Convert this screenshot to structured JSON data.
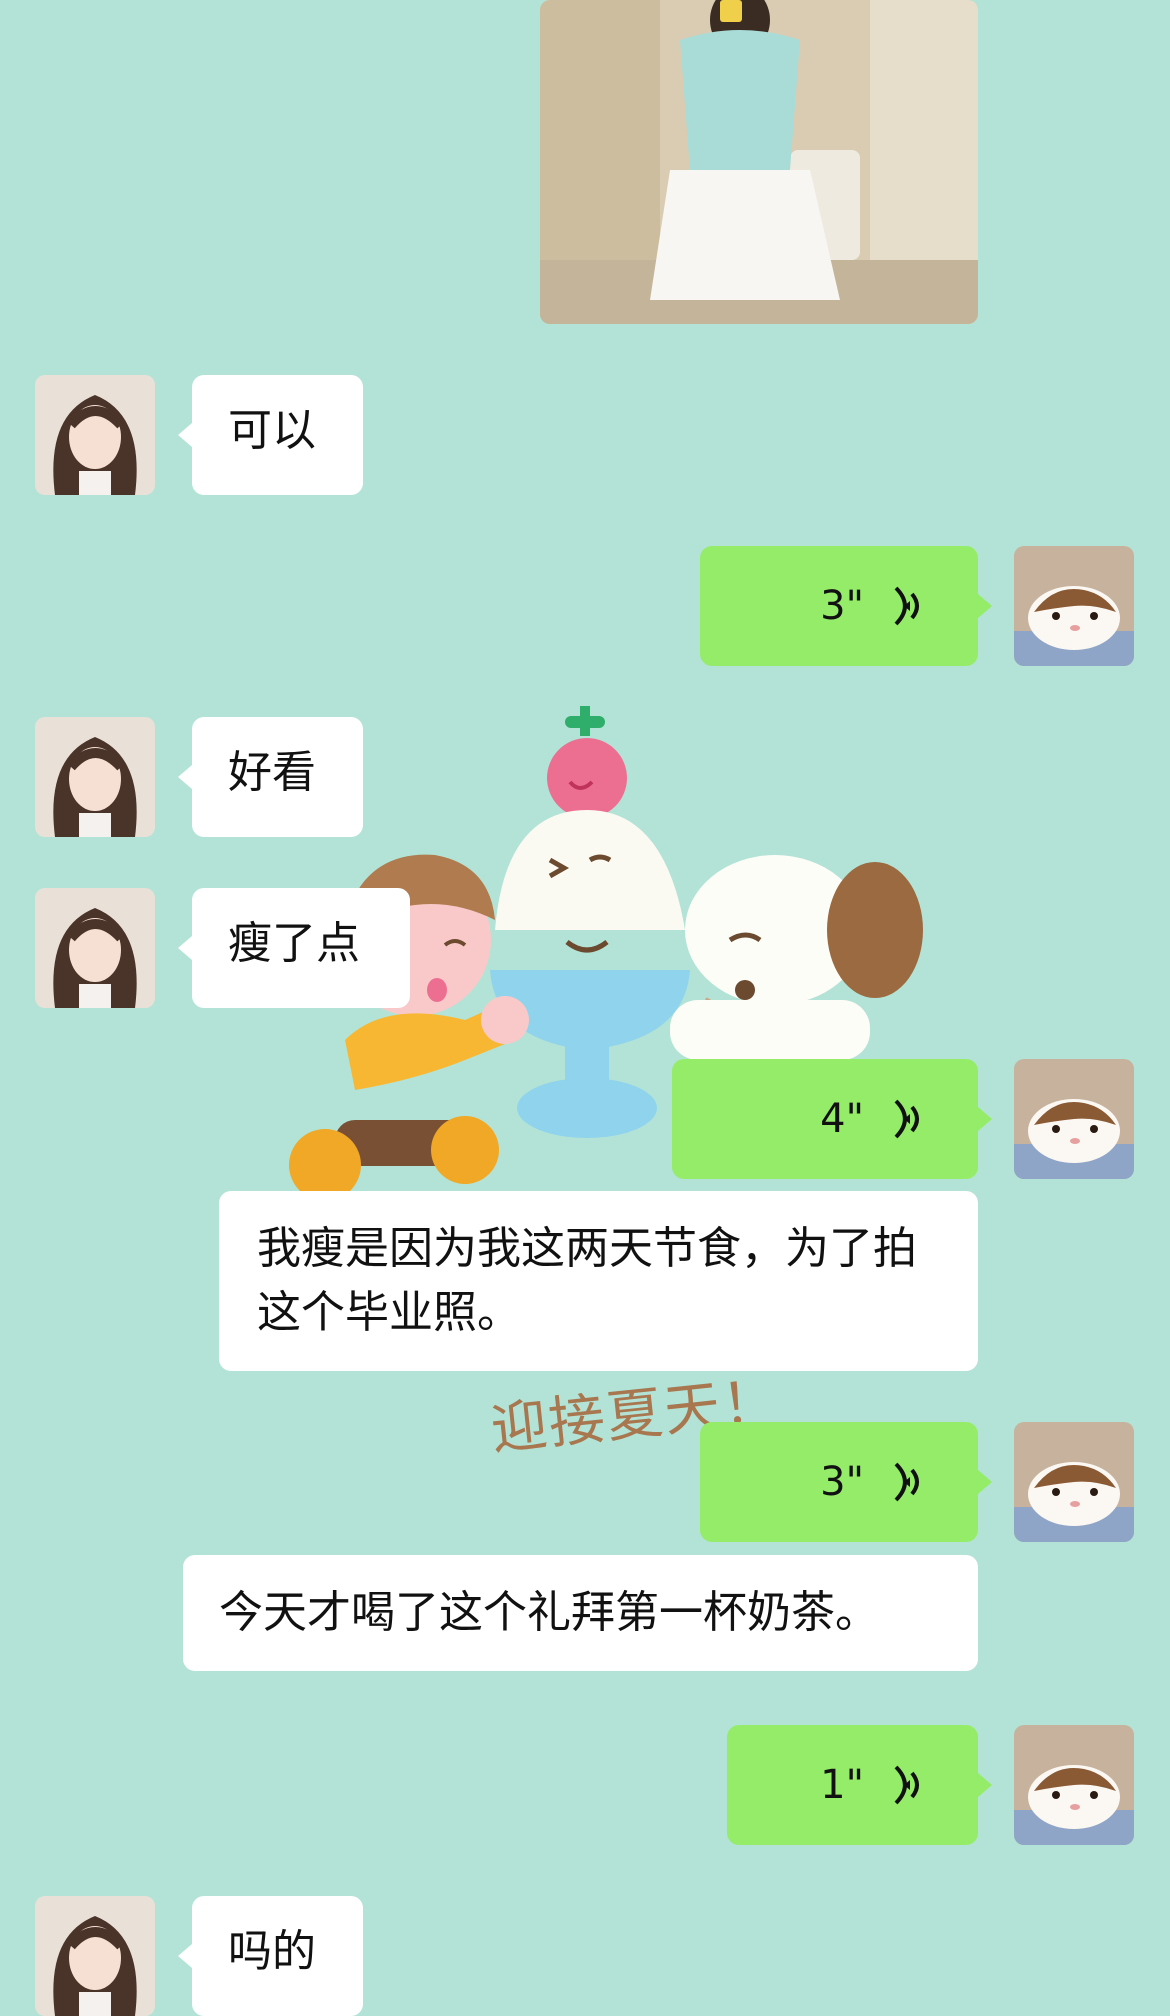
{
  "colors": {
    "background": "#b3e3d6",
    "incoming_bubble": "#ffffff",
    "outgoing_bubble": "#95ec69"
  },
  "messages": [
    {
      "side": "right",
      "type": "image",
      "description_icon": "photo-message"
    },
    {
      "side": "left",
      "type": "text",
      "text": "可以"
    },
    {
      "side": "right",
      "type": "voice",
      "duration": "3\""
    },
    {
      "side": "left",
      "type": "text",
      "text": "好看"
    },
    {
      "side": "left",
      "type": "text",
      "text": "瘦了点"
    },
    {
      "side": "right",
      "type": "voice",
      "duration": "4\""
    },
    {
      "side": "left",
      "type": "text",
      "text": "我瘦是因为我这两天节食，为了拍这个毕业照。"
    },
    {
      "side": "right",
      "type": "voice",
      "duration": "3\""
    },
    {
      "side": "left",
      "type": "text",
      "text": "今天才喝了这个礼拜第一杯奶茶。"
    },
    {
      "side": "right",
      "type": "voice",
      "duration": "1\""
    },
    {
      "side": "left",
      "type": "text",
      "text": "吗的"
    }
  ],
  "sticker": {
    "caption": "迎接夏天！"
  }
}
